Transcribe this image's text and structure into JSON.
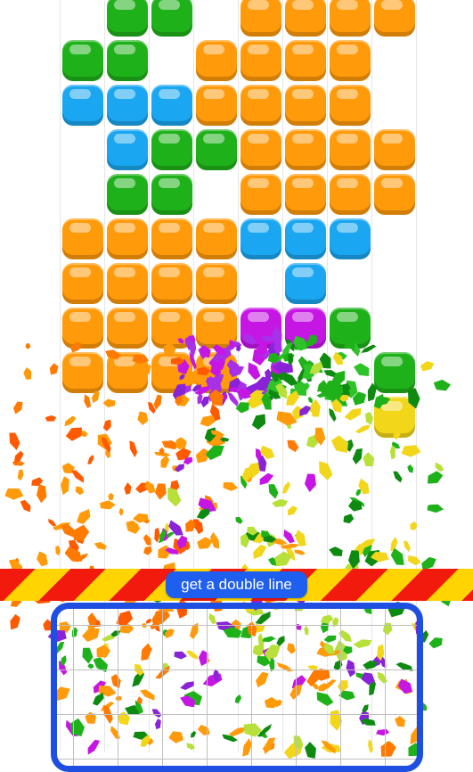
{
  "game": {
    "banner_text": "get a double line"
  },
  "colors": {
    "orange": "#ff9a0a",
    "green": "#1fb11a",
    "blue": "#1aa6f0",
    "magenta": "#c616e4",
    "yellow": "#f2d61a",
    "red_stripe": "#f21a0c",
    "yellow_stripe": "#ffd400",
    "tray_border": "#1f4fe0",
    "label_bg": "#1f5ff0"
  },
  "icons": {
    "banner": "hazard-stripe-banner",
    "tray": "piece-tray-grid"
  }
}
